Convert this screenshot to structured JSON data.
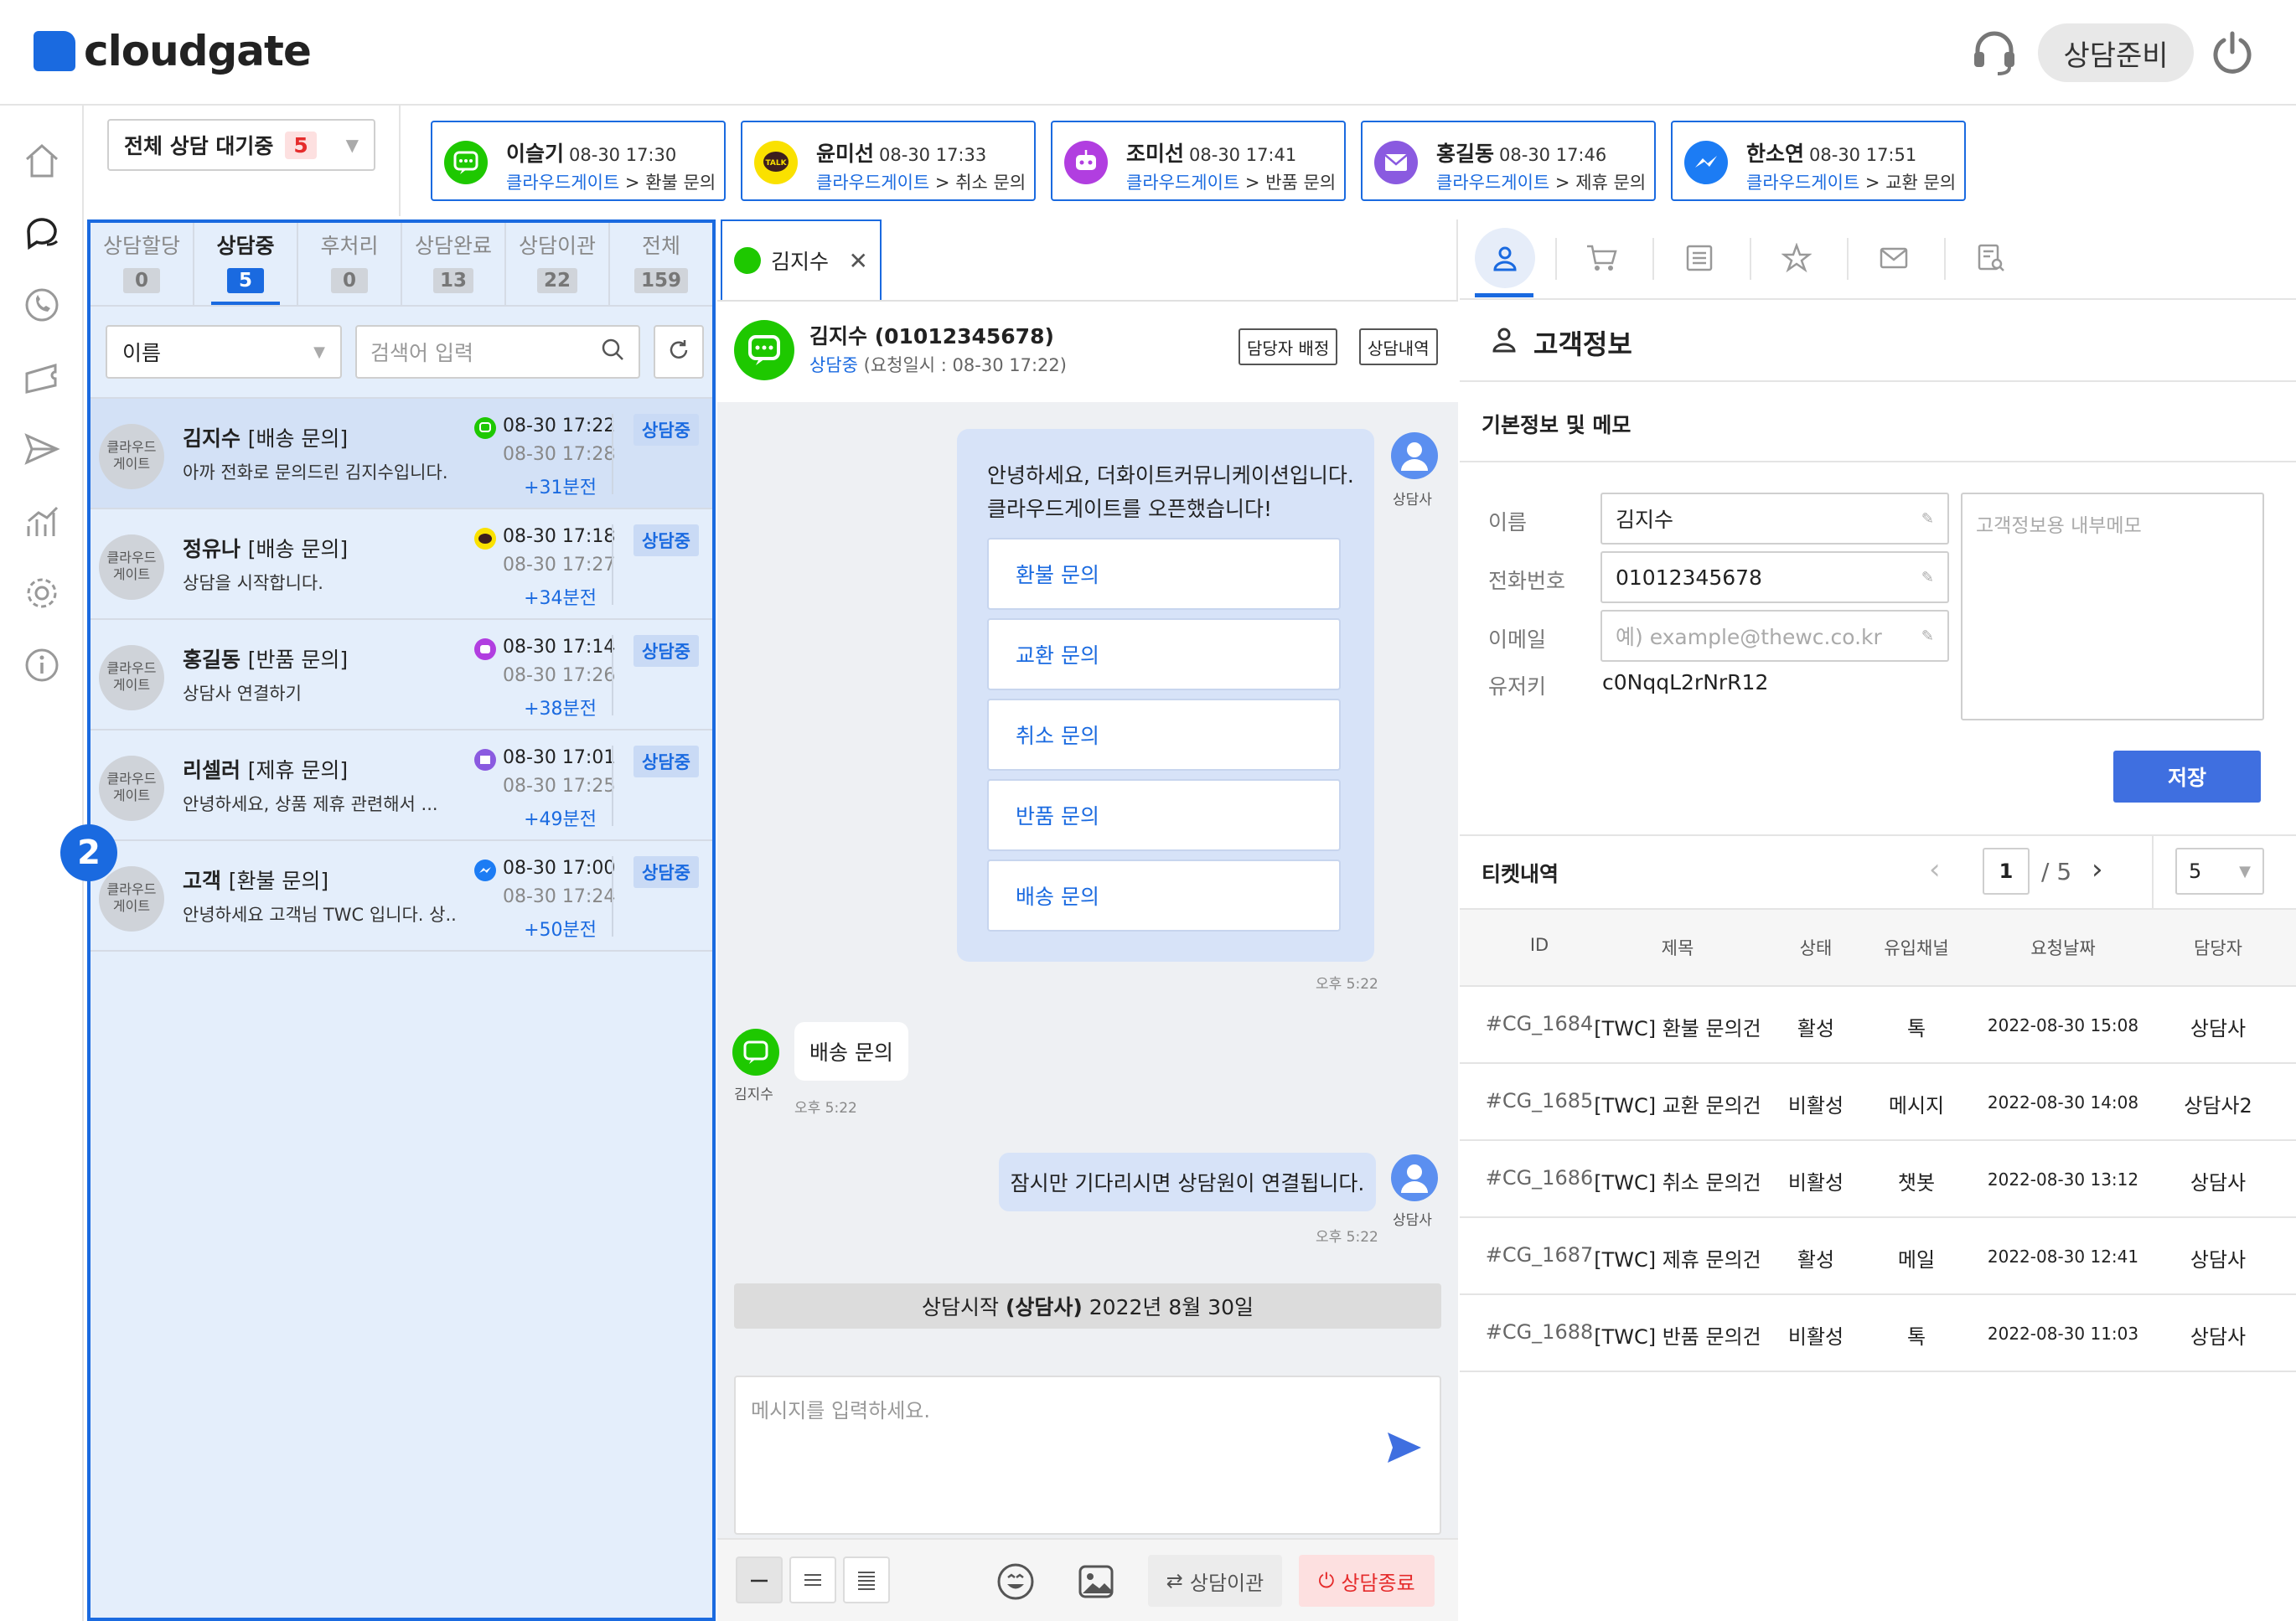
{
  "app": {
    "brand": "cloudgate",
    "status_label": "상담준비",
    "accent": "#1a6ae0"
  },
  "queue": {
    "label": "전체 상담 대기중",
    "count": "5"
  },
  "waiting": [
    {
      "name": "이슬기",
      "time": "08-30 17:30",
      "company": "클라우드게이트",
      "topic": "환불 문의",
      "channel": "line-icon"
    },
    {
      "name": "윤미선",
      "time": "08-30 17:33",
      "company": "클라우드게이트",
      "topic": "취소 문의",
      "channel": "kakaotalk-icon"
    },
    {
      "name": "조미선",
      "time": "08-30 17:41",
      "company": "클라우드게이트",
      "topic": "반품 문의",
      "channel": "chatbot-icon"
    },
    {
      "name": "홍길동",
      "time": "08-30 17:46",
      "company": "클라우드게이트",
      "topic": "제휴 문의",
      "channel": "mail-icon"
    },
    {
      "name": "한소연",
      "time": "08-30 17:51",
      "company": "클라우드게이트",
      "topic": "교환 문의",
      "channel": "messenger-icon"
    }
  ],
  "tabs": [
    {
      "label": "상담할당",
      "count": "0"
    },
    {
      "label": "상담중",
      "count": "5"
    },
    {
      "label": "후처리",
      "count": "0"
    },
    {
      "label": "상담완료",
      "count": "13"
    },
    {
      "label": "상담이관",
      "count": "22"
    },
    {
      "label": "전체",
      "count": "159"
    }
  ],
  "filter": {
    "field": "이름",
    "search_placeholder": "검색어 입력"
  },
  "conversations": [
    {
      "avatar_l1": "클라우드",
      "avatar_l2": "게이트",
      "name": "김지수",
      "topic": "[배송 문의]",
      "preview": "아까 전화로 문의드린 김지수입니다.",
      "started": "08-30 17:22",
      "last": "08-30 17:28",
      "elapsed": "+31분전",
      "status": "상담중",
      "channel": "line-icon"
    },
    {
      "avatar_l1": "클라우드",
      "avatar_l2": "게이트",
      "name": "정유나",
      "topic": "[배송 문의]",
      "preview": "상담을 시작합니다.",
      "started": "08-30 17:18",
      "last": "08-30 17:27",
      "elapsed": "+34분전",
      "status": "상담중",
      "channel": "kakaotalk-icon"
    },
    {
      "avatar_l1": "클라우드",
      "avatar_l2": "게이트",
      "name": "홍길동",
      "topic": "[반품 문의]",
      "preview": "상담사 연결하기",
      "started": "08-30 17:14",
      "last": "08-30 17:26",
      "elapsed": "+38분전",
      "status": "상담중",
      "channel": "chatbot-icon"
    },
    {
      "avatar_l1": "클라우드",
      "avatar_l2": "게이트",
      "name": "리셀러",
      "topic": "[제휴 문의]",
      "preview": "안녕하세요, 상품 제휴 관련해서 ...",
      "started": "08-30 17:01",
      "last": "08-30 17:25",
      "elapsed": "+49분전",
      "status": "상담중",
      "channel": "mail-icon"
    },
    {
      "avatar_l1": "클라우드",
      "avatar_l2": "게이트",
      "name": "고객",
      "topic": "[환불 문의]",
      "preview": "안녕하세요 고객님 TWC 입니다. 상..",
      "started": "08-30 17:00",
      "last": "08-30 17:24",
      "elapsed": "+50분전",
      "status": "상담중",
      "channel": "messenger-icon"
    }
  ],
  "marker": "2",
  "chat": {
    "tab_label": "김지수",
    "header_name": "김지수 (01012345678)",
    "header_status": "상담중",
    "header_requested": "(요청일시 : 08-30 17:22)",
    "assign_btn": "담당자 배정",
    "history_btn": "상담내역",
    "greeting_l1": "안녕하세요, 더화이트커뮤니케이션입니다.",
    "greeting_l2": "클라우드게이트를 오픈했습니다!",
    "options": [
      "환불 문의",
      "교환 문의",
      "취소 문의",
      "반품 문의",
      "배송 문의"
    ],
    "agent_label": "상담사",
    "time1": "오후 5:22",
    "customer_label": "김지수",
    "customer_msg": "배송 문의",
    "time2": "오후 5:22",
    "agent_msg2": "잠시만 기다리시면 상담원이 연결됩니다.",
    "time3": "오후 5:22",
    "session_prefix": "상담시작",
    "session_agent": "(상담사)",
    "session_date": "2022년 8월 30일",
    "input_placeholder": "메시지를 입력하세요.",
    "transfer_btn": "상담이관",
    "end_btn": "상담종료"
  },
  "customer": {
    "title": "고객정보",
    "section": "기본정보 및 메모",
    "name_label": "이름",
    "name": "김지수",
    "phone_label": "전화번호",
    "phone": "01012345678",
    "email_label": "이메일",
    "email_placeholder": "예) example@thewc.co.kr",
    "userkey_label": "유저키",
    "userkey": "c0NqqL2rNrR12",
    "memo_placeholder": "고객정보용 내부메모",
    "save_btn": "저장"
  },
  "tickets": {
    "title": "티켓내역",
    "page": "1",
    "total": "/ 5",
    "page_size": "5",
    "columns": [
      "ID",
      "제목",
      "상태",
      "유입채널",
      "요청날짜",
      "담당자"
    ],
    "rows": [
      [
        "#CG_1684",
        "[TWC] 환불 문의건",
        "활성",
        "톡",
        "2022-08-30 15:08",
        "상담사"
      ],
      [
        "#CG_1685",
        "[TWC] 교환 문의건",
        "비활성",
        "메시지",
        "2022-08-30 14:08",
        "상담사2"
      ],
      [
        "#CG_1686",
        "[TWC] 취소 문의건",
        "비활성",
        "챗봇",
        "2022-08-30 13:12",
        "상담사"
      ],
      [
        "#CG_1687",
        "[TWC] 제휴 문의건",
        "활성",
        "메일",
        "2022-08-30 12:41",
        "상담사"
      ],
      [
        "#CG_1688",
        "[TWC] 반품 문의건",
        "비활성",
        "톡",
        "2022-08-30 11:03",
        "상담사"
      ]
    ]
  }
}
